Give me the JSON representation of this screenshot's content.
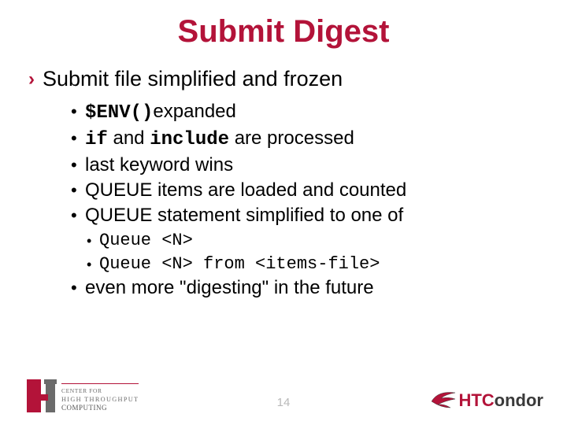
{
  "title": "Submit Digest",
  "lvl1": "Submit file simplified and frozen",
  "b1": {
    "code": "$ENV()",
    "text": "expanded"
  },
  "b2": {
    "code1": "if",
    "mid": " and ",
    "code2": "include",
    "text": " are processed"
  },
  "b3": "last keyword wins",
  "b4": "QUEUE items are loaded and counted",
  "b5": "QUEUE statement simplified to one of",
  "s1": "Queue <N>",
  "s2": "Queue <N> from <items-file>",
  "b6": "even more \"digesting\" in the future",
  "page": "14",
  "left_logo": {
    "l1": "CENTER FOR",
    "l2": "HIGH THROUGHPUT",
    "l3": "COMPUTING"
  },
  "right_logo": {
    "ht": "HTC",
    "cd": "ondor"
  }
}
